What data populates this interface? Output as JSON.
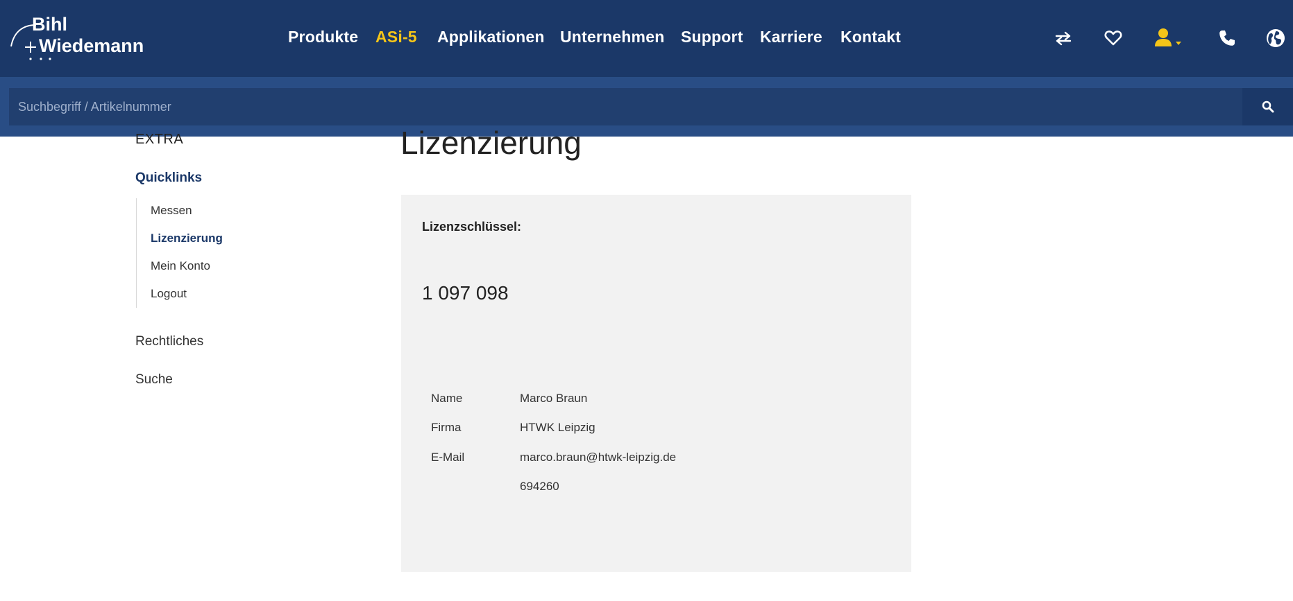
{
  "brand": {
    "logo_line1": "Bihl",
    "logo_line2": "Wiedemann",
    "colors": {
      "primary": "#1b3868",
      "accent": "#f5c518",
      "search_bg": "#294d85",
      "card_bg": "#f2f2f2"
    }
  },
  "nav": {
    "items": [
      {
        "label": "Produkte"
      },
      {
        "label": "ASi-5",
        "active": true
      },
      {
        "label": "Applikationen"
      },
      {
        "label": "Unternehmen"
      },
      {
        "label": "Support"
      },
      {
        "label": "Karriere"
      },
      {
        "label": "Kontakt"
      }
    ],
    "icons": [
      "compare-arrows-icon",
      "heart-icon",
      "user-icon",
      "phone-icon",
      "globe-icon"
    ]
  },
  "search": {
    "placeholder": "Suchbegriff / Artikelnummer",
    "value": "",
    "button_icon": "search-icon"
  },
  "sidebar": {
    "extra": "EXTRA",
    "quicklinks": "Quicklinks",
    "sub_items": [
      {
        "label": "Messen"
      },
      {
        "label": "Lizenzierung",
        "current": true
      },
      {
        "label": "Mein Konto"
      },
      {
        "label": "Logout"
      }
    ],
    "rechtliches": "Rechtliches",
    "suche": "Suche"
  },
  "main": {
    "title": "Lizenzierung",
    "license_key_label": "Lizenzschlüssel:",
    "license_key_value": "1 097 098",
    "info": [
      {
        "label": "Name",
        "value": "Marco Braun"
      },
      {
        "label": "Firma",
        "value": "HTWK Leipzig"
      },
      {
        "label": "E-Mail",
        "value": "marco.braun@htwk-leipzig.de"
      },
      {
        "label": "",
        "value": "694260"
      }
    ]
  }
}
